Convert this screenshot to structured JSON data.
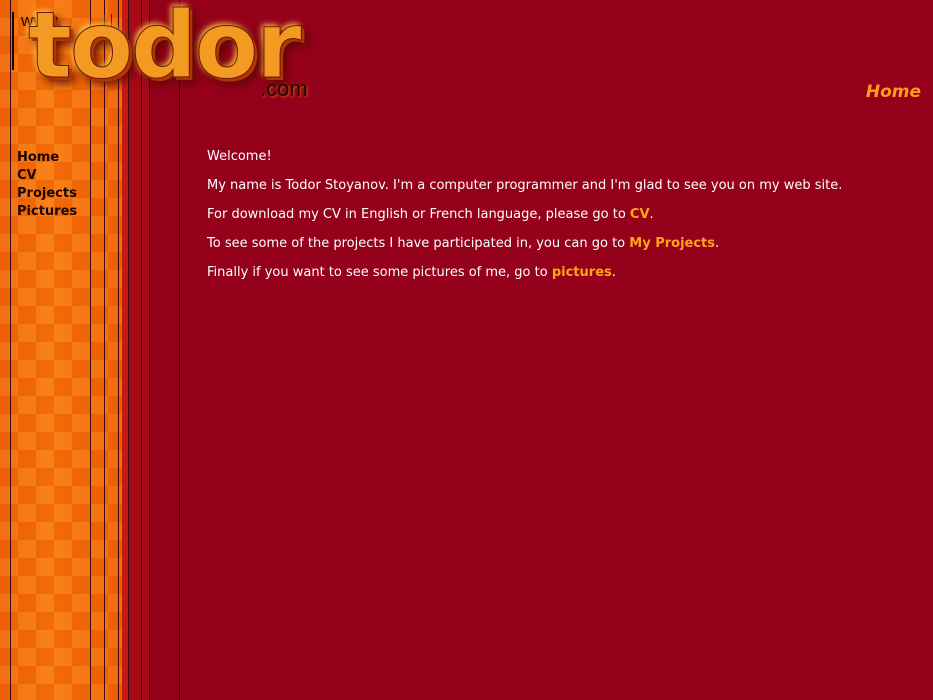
{
  "logo": {
    "www": "www.",
    "name": "todor",
    "tld": ".com"
  },
  "header": {
    "section_title": "Home"
  },
  "nav": {
    "items": [
      {
        "label": "Home"
      },
      {
        "label": "CV"
      },
      {
        "label": "Projects"
      },
      {
        "label": "Pictures"
      }
    ]
  },
  "content": {
    "welcome": "Welcome!",
    "intro": "My name is Todor Stoyanov. I'm a computer programmer and I'm glad to see you on my web site.",
    "cv_text": "For download my CV in English or French language, please go to ",
    "cv_link": "CV",
    "projects_text": "To see some of the projects I have participated in, you can go to ",
    "projects_link": "My Projects",
    "pictures_text": "Finally if you want to see some pictures of me, go to ",
    "pictures_link": "pictures",
    "period": "."
  },
  "colors": {
    "background": "#95001b",
    "sidebar": "#f06a06",
    "link": "#ffa318",
    "nav_text": "#1b0500"
  }
}
